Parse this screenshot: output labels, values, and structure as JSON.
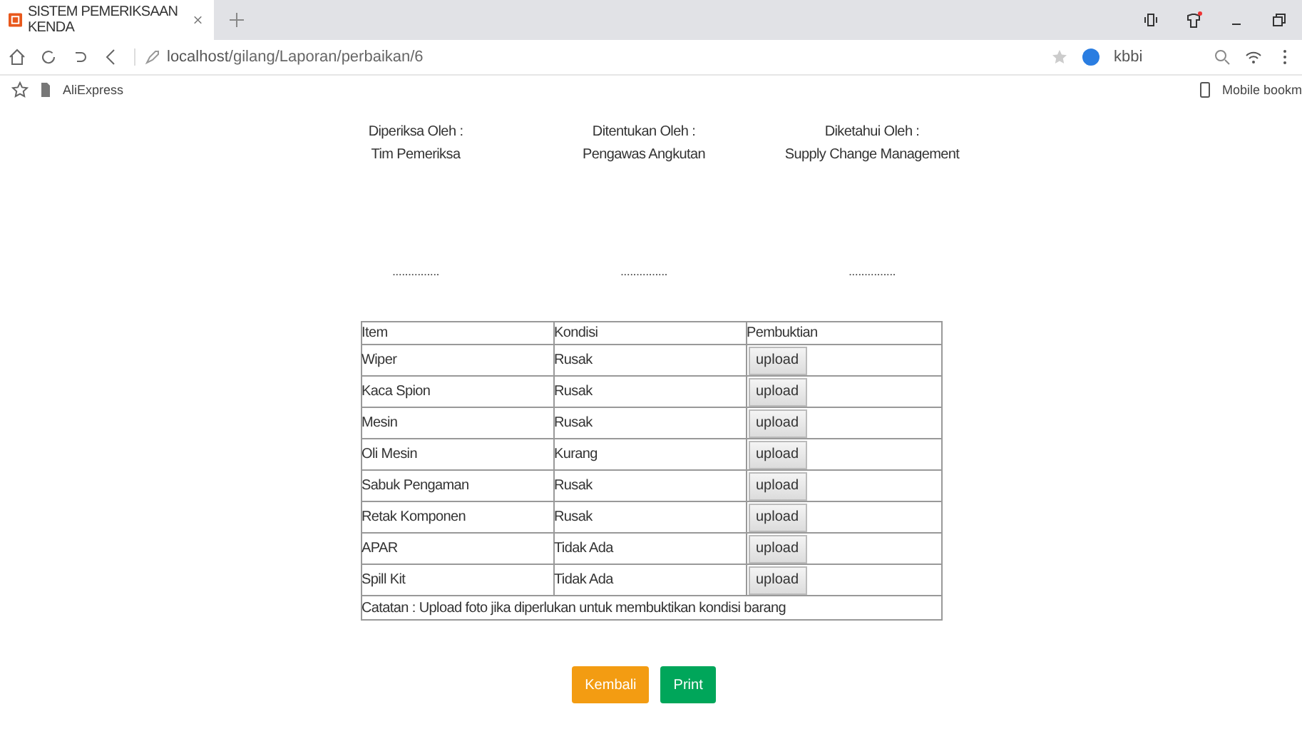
{
  "browser": {
    "tab_title": "SISTEM PEMERIKSAAN KENDA",
    "url_host": "localhost",
    "url_path": "/gilang/Laporan/perbaikan/6",
    "search_text": "kbbi",
    "bookmarks": [
      "AliExpress"
    ],
    "mobile_bookmarks": "Mobile bookm"
  },
  "signatures": [
    {
      "role": "Diperiksa Oleh :",
      "name": "Tim Pemeriksa",
      "line": "..............."
    },
    {
      "role": "Ditentukan Oleh :",
      "name": "Pengawas Angkutan",
      "line": "..............."
    },
    {
      "role": "Diketahui Oleh :",
      "name": "Supply Change Management",
      "line": "..............."
    }
  ],
  "table": {
    "columns": [
      "Item",
      "Kondisi",
      "Pembuktian"
    ],
    "rows": [
      {
        "item": "Wiper",
        "kondisi": "Rusak",
        "button": "upload"
      },
      {
        "item": "Kaca Spion",
        "kondisi": "Rusak",
        "button": "upload"
      },
      {
        "item": "Mesin",
        "kondisi": "Rusak",
        "button": "upload"
      },
      {
        "item": "Oli Mesin",
        "kondisi": "Kurang",
        "button": "upload"
      },
      {
        "item": "Sabuk Pengaman",
        "kondisi": "Rusak",
        "button": "upload"
      },
      {
        "item": "Retak Komponen",
        "kondisi": "Rusak",
        "button": "upload"
      },
      {
        "item": "APAR",
        "kondisi": "Tidak Ada",
        "button": "upload"
      },
      {
        "item": "Spill Kit",
        "kondisi": "Tidak Ada",
        "button": "upload"
      }
    ],
    "note": "Catatan : Upload foto jika diperlukan untuk membuktikan kondisi barang"
  },
  "buttons": [
    {
      "label": "Kembali",
      "kind": "back"
    },
    {
      "label": "Print",
      "kind": "print"
    }
  ]
}
